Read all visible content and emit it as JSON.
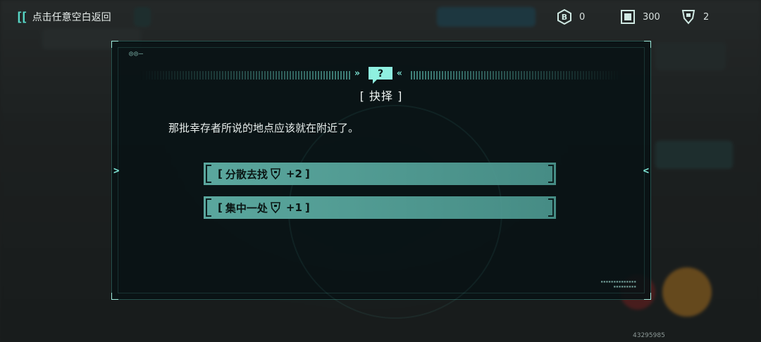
{
  "topbar": {
    "back_label": "点击任意空白返回",
    "currencies": [
      {
        "icon": "b-coin-icon",
        "value": "0"
      },
      {
        "icon": "chip-card-icon",
        "value": "300"
      },
      {
        "icon": "survivor-tag-icon",
        "value": "2"
      }
    ]
  },
  "dialog": {
    "title": "[ 抉择 ]",
    "text": "那批幸存者所说的地点应该就在附近了。",
    "options": [
      {
        "bracket": "[",
        "label": "分散去找",
        "icon": "survivor-tag-icon",
        "bonus": "+2",
        "close": "]"
      },
      {
        "bracket": "[",
        "label": "集中一处",
        "icon": "survivor-tag-icon",
        "bonus": "+1",
        "close": "]"
      }
    ]
  },
  "footer": {
    "id": "43295985"
  },
  "colors": {
    "accent": "#58d8c8",
    "option_bg": "#5faf a5"
  }
}
